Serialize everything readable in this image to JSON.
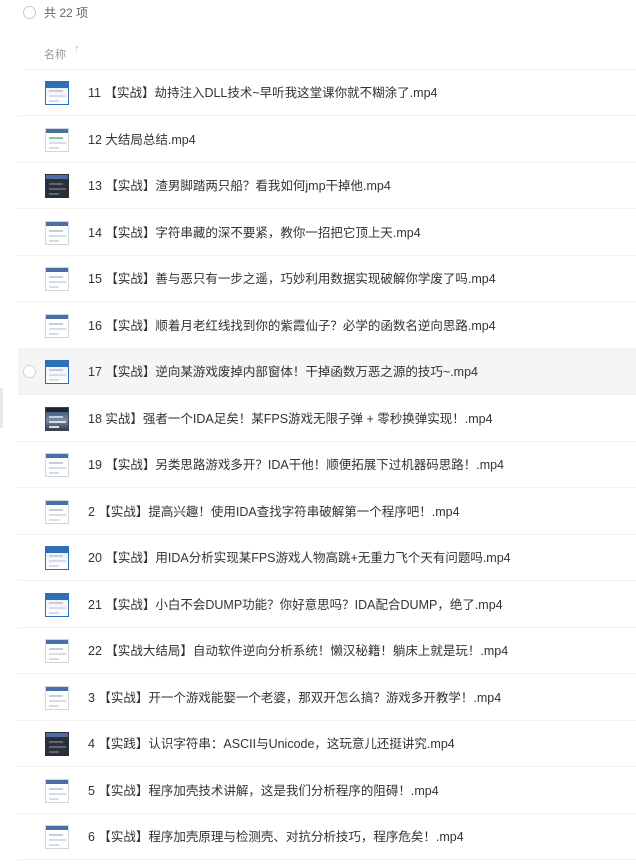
{
  "header": {
    "total_label": "共 22 项",
    "column_name": "名称",
    "sort_icon": "↑"
  },
  "rows": [
    {
      "name": "11 【实战】劫持注入DLL技术~早听我这堂课你就不糊涂了.mp4",
      "thumb": "blue"
    },
    {
      "name": "12 大结局总结.mp4",
      "thumb": "green"
    },
    {
      "name": "13 【实战】渣男脚踏两只船？看我如何jmp干掉他.mp4",
      "thumb": "dark"
    },
    {
      "name": "14 【实战】字符串藏的深不要紧，教你一招把它顶上天.mp4",
      "thumb": "plain"
    },
    {
      "name": "15 【实战】善与恶只有一步之遥，巧妙利用数据实现破解你学废了吗.mp4",
      "thumb": "plain"
    },
    {
      "name": "16 【实战】顺着月老红线找到你的紫霞仙子？必学的函数名逆向思路.mp4",
      "thumb": "plain"
    },
    {
      "name": "17 【实战】逆向某游戏废掉内部窗体！干掉函数万恶之源的技巧~.mp4",
      "thumb": "blue",
      "highlight": true
    },
    {
      "name": "18 实战】强者一个IDA足矣！某FPS游戏无限子弹 + 零秒换弹实现！.mp4",
      "thumb": "photo"
    },
    {
      "name": "19 【实战】另类思路游戏多开？IDA干他！顺便拓展下过机器码思路！.mp4",
      "thumb": "plain"
    },
    {
      "name": "2 【实战】提高兴趣！使用IDA查找字符串破解第一个程序吧！.mp4",
      "thumb": "plain"
    },
    {
      "name": "20 【实战】用IDA分析实现某FPS游戏人物高跳+无重力飞个天有问题吗.mp4",
      "thumb": "blue"
    },
    {
      "name": "21 【实战】小白不会DUMP功能？你好意思吗？IDA配合DUMP，绝了.mp4",
      "thumb": "blue"
    },
    {
      "name": "22 【实战大结局】自动软件逆向分析系统！懒汉秘籍！躺床上就是玩！.mp4",
      "thumb": "plain"
    },
    {
      "name": "3 【实战】开一个游戏能娶一个老婆，那双开怎么搞？游戏多开教学！.mp4",
      "thumb": "plain"
    },
    {
      "name": "4 【实践】认识字符串：ASCII与Unicode，这玩意儿还挺讲究.mp4",
      "thumb": "dark"
    },
    {
      "name": "5 【实战】程序加壳技术讲解，这是我们分析程序的阻碍！.mp4",
      "thumb": "plain"
    },
    {
      "name": "6 【实战】程序加壳原理与检测壳、对抗分析技巧，程序危矣！.mp4",
      "thumb": "plain"
    }
  ]
}
